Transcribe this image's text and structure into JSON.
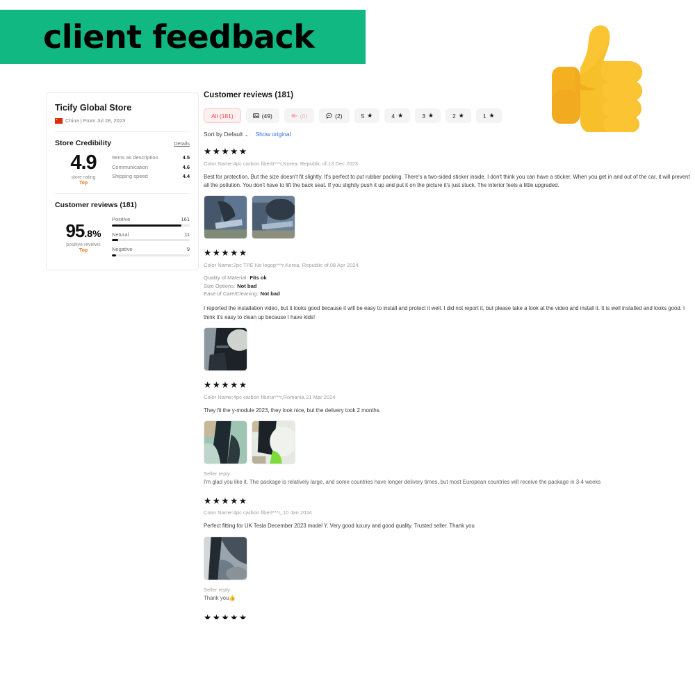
{
  "banner": {
    "text": "client feedback",
    "bg_color": "#11b881",
    "text_color": "#000000"
  },
  "emoji": {
    "name": "thumbs-up-emoji",
    "glyph": "👍"
  },
  "store_card": {
    "name": "Ticify Global Store",
    "flag": "china-flag-icon",
    "origin": "China | From Jul 28, 2023",
    "credibility": {
      "title": "Store Credibility",
      "details_label": "Details",
      "score": "4.9",
      "score_caption": "store rating",
      "top_badge": "Top",
      "metrics": [
        {
          "label": "Items as description",
          "value": "4.5"
        },
        {
          "label": "Communication",
          "value": "4.6"
        },
        {
          "label": "Shipping speed",
          "value": "4.4"
        }
      ]
    },
    "reviews_summary": {
      "title": "Customer reviews (181)",
      "percent_main": "95",
      "percent_sub": ".8%",
      "percent_caption": "positive reviews",
      "top_badge": "Top",
      "bars": [
        {
          "label": "Positive",
          "count": "161",
          "pct": 89
        },
        {
          "label": "Netural",
          "count": "11",
          "pct": 6
        },
        {
          "label": "Negative",
          "count": "9",
          "pct": 4
        }
      ]
    }
  },
  "reviews_panel": {
    "heading": "Customer reviews (181)",
    "filters": [
      {
        "name": "filter-all",
        "icon": "",
        "label": "All (181)",
        "active": true,
        "muted": false
      },
      {
        "name": "filter-photos",
        "icon": "image-icon",
        "label": "(49)",
        "active": false,
        "muted": false
      },
      {
        "name": "filter-videos",
        "icon": "video-icon",
        "label": "(0)",
        "active": false,
        "muted": true
      },
      {
        "name": "filter-comments",
        "icon": "comment-icon",
        "label": "(2)",
        "active": false,
        "muted": false
      },
      {
        "name": "filter-5-star",
        "icon": "star-icon",
        "label": "5",
        "active": false,
        "muted": false
      },
      {
        "name": "filter-4-star",
        "icon": "star-icon",
        "label": "4",
        "active": false,
        "muted": false
      },
      {
        "name": "filter-3-star",
        "icon": "star-icon",
        "label": "3",
        "active": false,
        "muted": false
      },
      {
        "name": "filter-2-star",
        "icon": "star-icon",
        "label": "2",
        "active": false,
        "muted": false
      },
      {
        "name": "filter-1-star",
        "icon": "star-icon",
        "label": "1",
        "active": false,
        "muted": false
      }
    ],
    "sort_label": "Sort by Default",
    "sort_caret": "⌄",
    "show_original_label": "Show original",
    "reviews": [
      {
        "stars": "★★★★★",
        "meta": "Color Name:4pc carbon fiberb***r,Korea, Republic of,13 Dec 2023",
        "attributes": [],
        "body": "Best for protection. But the size doesn't fit slightly. It's perfect to put rubber packing. There's a two-sided sticker inside. I don't think you can have a sticker. When you get in and out of the car, it will prevent all the pollution. You don't have to lift the back seat. If you slightly push it up and put it on the picture it's just stuck. The interior feels a little upgraded.",
        "thumbnails": 2,
        "reply_label": "",
        "reply_text": ""
      },
      {
        "stars": "★★★★★",
        "meta": "Color Name:2pc TPE No logop***r,Korea, Republic of,08 Apr 2024",
        "attributes": [
          {
            "label": "Quality of Material:",
            "value": "Fits ok"
          },
          {
            "label": "Size Options:",
            "value": "Not bad"
          },
          {
            "label": "Ease of Care/Cleaning:",
            "value": "Not bad"
          }
        ],
        "body": "I reported the installation video, but it looks good because it will be easy to install and protect it well. I did not report it, but please take a look at the video and install it. It is well installed and looks good. I think it's easy to clean up because I have kids!",
        "thumbnails": 1,
        "reply_label": "",
        "reply_text": ""
      },
      {
        "stars": "★★★★★",
        "meta": "Color Name:4pc carbon fibera***r,Romania,21 Mar 2024",
        "attributes": [],
        "body": "They fit the y-module 2023, they look nice, but the delivery took 2 months.",
        "thumbnails": 2,
        "reply_label": "Seller reply:",
        "reply_text": "I'm glad you like it. The package is relatively large, and some countries have longer delivery times, but most European countries will receive the package in 3-4 weeks"
      },
      {
        "stars": "★★★★★",
        "meta": "Color Name:4pc carbon fiberl***r,,10 Jan 2024",
        "attributes": [],
        "body": "Perfect fitting for UK Tesla December 2023 model Y. Very good luxury and good quality. Trusted seller. Thank you",
        "thumbnails": 1,
        "reply_label": "Seller reply:",
        "reply_text": "Thank you👍"
      }
    ],
    "cut_off_stars": "★★★★★"
  }
}
